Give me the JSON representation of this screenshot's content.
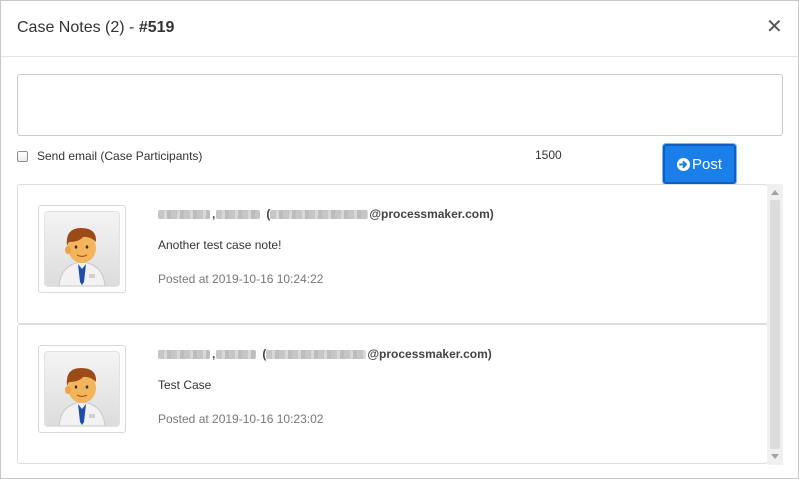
{
  "dialog": {
    "title_prefix": "Case Notes (2) - ",
    "case_number": "#519",
    "close_glyph": "✕"
  },
  "composer": {
    "textarea_value": "",
    "send_email_label": "Send email (Case Participants)",
    "send_email_checked": false,
    "char_limit": "1500",
    "post_label": "Post",
    "post_icon": "arrow-right-circle-icon"
  },
  "notes": [
    {
      "user_redacted": true,
      "email_suffix": "@processmaker.com)",
      "text": "Another test case note!",
      "posted": "Posted at 2019-10-16 10:24:22"
    },
    {
      "user_redacted": true,
      "email_suffix": "@processmaker.com)",
      "text": "Test Case",
      "posted": "Posted at 2019-10-16 10:23:02"
    }
  ],
  "colors": {
    "post_button": "#1a7fe8",
    "posted_text": "#777777"
  }
}
